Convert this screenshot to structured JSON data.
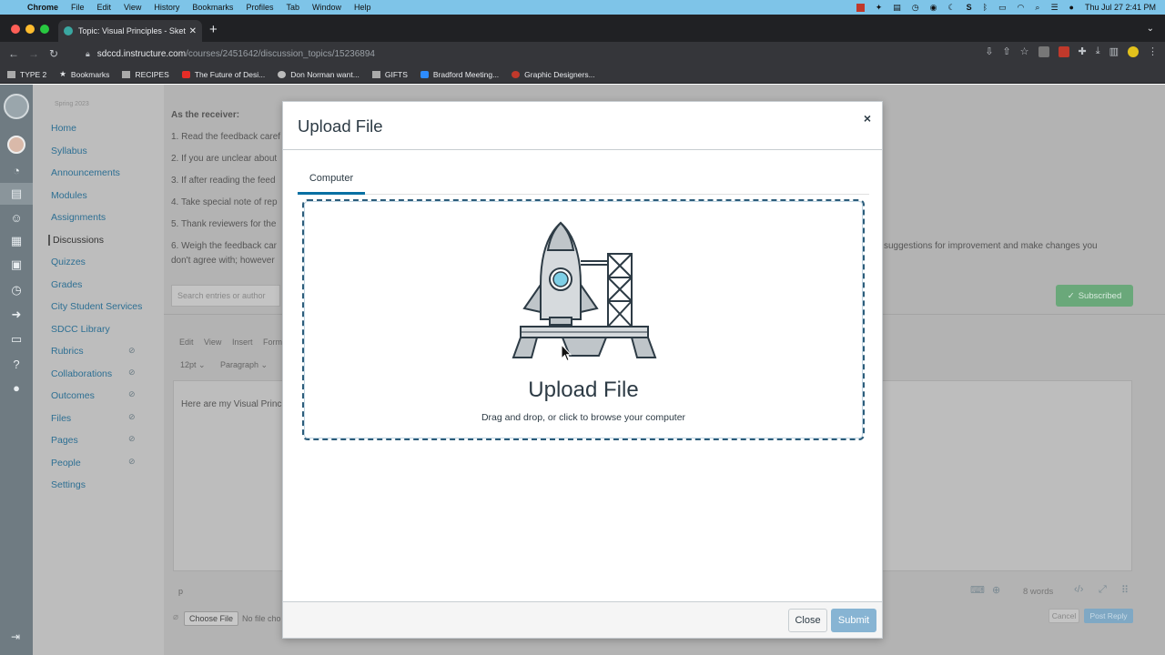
{
  "menubar": {
    "app": "Chrome",
    "items": [
      "File",
      "Edit",
      "View",
      "History",
      "Bookmarks",
      "Profiles",
      "Tab",
      "Window",
      "Help"
    ],
    "datetime": "Thu Jul 27  2:41 PM"
  },
  "browser": {
    "tab_title": "Topic: Visual Principles - Sketc",
    "url_host": "sdccd.instructure.com",
    "url_path": "/courses/2451642/discussion_topics/15236894",
    "bookmarks": [
      {
        "label": "TYPE 2",
        "icon": "folder"
      },
      {
        "label": "Bookmarks",
        "icon": "star"
      },
      {
        "label": "RECIPES",
        "icon": "folder"
      },
      {
        "label": "The Future of Desi...",
        "icon": "youtube"
      },
      {
        "label": "Don Norman want...",
        "icon": "globe"
      },
      {
        "label": "GIFTS",
        "icon": "folder"
      },
      {
        "label": "Bradford Meeting...",
        "icon": "zoom"
      },
      {
        "label": "Graphic Designers...",
        "icon": "red-dot"
      }
    ]
  },
  "course_nav": {
    "term": "Spring 2023",
    "items": [
      {
        "label": "Home",
        "hidden": false
      },
      {
        "label": "Syllabus",
        "hidden": false
      },
      {
        "label": "Announcements",
        "hidden": false
      },
      {
        "label": "Modules",
        "hidden": false
      },
      {
        "label": "Assignments",
        "hidden": false
      },
      {
        "label": "Discussions",
        "hidden": false,
        "active": true
      },
      {
        "label": "Quizzes",
        "hidden": false
      },
      {
        "label": "Grades",
        "hidden": false
      },
      {
        "label": "City Student Services",
        "hidden": false
      },
      {
        "label": "SDCC Library",
        "hidden": false
      },
      {
        "label": "Rubrics",
        "hidden": true
      },
      {
        "label": "Collaborations",
        "hidden": true
      },
      {
        "label": "Outcomes",
        "hidden": true
      },
      {
        "label": "Files",
        "hidden": true
      },
      {
        "label": "Pages",
        "hidden": true
      },
      {
        "label": "People",
        "hidden": true
      },
      {
        "label": "Settings",
        "hidden": false
      }
    ]
  },
  "page": {
    "heading": "As the receiver:",
    "lines": [
      "1. Read the feedback caref",
      "2. If you are unclear about",
      "3. If after reading the feed",
      "4. Take special note of rep",
      "5. Thank reviewers for the",
      "6. Weigh the feedback car"
    ],
    "line6_right": "suggestions for improvement and make changes you",
    "line6_cont": "don't agree with; however",
    "search_placeholder": "Search entries or author",
    "subscribed_label": "Subscribed",
    "editor_menu": [
      "Edit",
      "View",
      "Insert",
      "Form"
    ],
    "font_size": "12pt",
    "block_format": "Paragraph",
    "editor_text": "Here are my Visual Princ",
    "status_path": "p",
    "word_count": "8 words",
    "choose_file": "Choose File",
    "no_file": "No file cho",
    "cancel": "Cancel",
    "post_reply": "Post Reply"
  },
  "modal": {
    "title": "Upload File",
    "close_symbol": "×",
    "tab": "Computer",
    "dropzone_title": "Upload File",
    "dropzone_subtitle": "Drag and drop, or click to browse your computer",
    "close_button": "Close",
    "submit_button": "Submit"
  },
  "colors": {
    "menubar": "#7ec4e8",
    "chrome_dark": "#202124",
    "chrome_toolbar": "#35363a",
    "canvas_link": "#2d6f93",
    "tab_underline": "#0770a3",
    "submit": "#87b4d3",
    "subscribed": "#6aa87a"
  }
}
